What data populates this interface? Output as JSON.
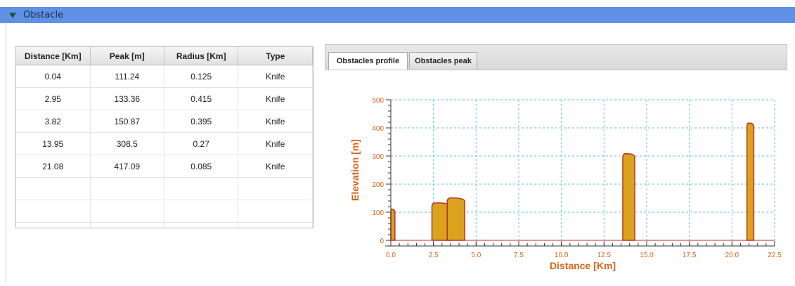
{
  "panel": {
    "title": "Obstacle"
  },
  "table": {
    "columns": [
      "Distance [Km]",
      "Peak [m]",
      "Radius [Km]",
      "Type"
    ],
    "rows": [
      [
        "0.04",
        "111.24",
        "0.125",
        "Knife"
      ],
      [
        "2.95",
        "133.36",
        "0.415",
        "Knife"
      ],
      [
        "3.82",
        "150.87",
        "0.395",
        "Knife"
      ],
      [
        "13.95",
        "308.5",
        "0.27",
        "Knife"
      ],
      [
        "21.08",
        "417.09",
        "0.085",
        "Knife"
      ]
    ]
  },
  "tabs": [
    "Obstacles profile",
    "Obstacles peak"
  ],
  "chart_data": {
    "type": "area",
    "xlabel": "Distance [Km]",
    "ylabel": "Elevation [m]",
    "xlim": [
      0,
      22.5
    ],
    "ylim": [
      0,
      500
    ],
    "x_ticks": [
      "0.0",
      "2.5",
      "5.0",
      "7.5",
      "10.0",
      "12.5",
      "15.0",
      "17.5",
      "20.0",
      "22.5"
    ],
    "y_ticks": [
      "0",
      "100",
      "200",
      "300",
      "400",
      "500"
    ],
    "grid": true,
    "obstacles": [
      {
        "distance": 0.04,
        "peak": 111.24,
        "radius": 0.125
      },
      {
        "distance": 2.95,
        "peak": 133.36,
        "radius": 0.415
      },
      {
        "distance": 3.82,
        "peak": 150.87,
        "radius": 0.395
      },
      {
        "distance": 13.95,
        "peak": 308.5,
        "radius": 0.27
      },
      {
        "distance": 21.08,
        "peak": 417.09,
        "radius": 0.085
      }
    ],
    "colors": {
      "fill": "#dba21e",
      "stroke": "#b8322a",
      "axis_text": "#d9631a",
      "grid": "#5cc3e6"
    }
  }
}
